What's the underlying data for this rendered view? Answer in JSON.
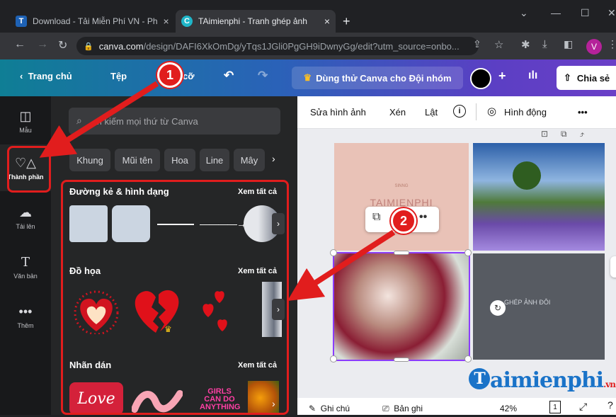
{
  "browser": {
    "tabs": [
      {
        "favicon": "T",
        "title": "Download - Tải Miễn Phí VN - Ph",
        "close": "×"
      },
      {
        "favicon": "C",
        "title": "TAimienphi - Tranh ghép ảnh",
        "close": "×"
      }
    ],
    "new_tab": "+",
    "url_domain": "canva.com",
    "url_path": "/design/DAFI6XkOmDg/yTqs1JGli0PgGH9iDwnyGg/edit?utm_source=onbo...",
    "profile_initial": "V"
  },
  "header": {
    "back_label": "Trang chủ",
    "file_label": "Tệp",
    "resize_label": "cỡ",
    "try_label": "Dùng thử Canva cho Đội nhóm",
    "share_label": "Chia sẻ"
  },
  "rail": {
    "items": [
      {
        "icon": "template-icon",
        "label": "Mẫu"
      },
      {
        "icon": "elements-icon",
        "label": "Thành phần"
      },
      {
        "icon": "upload-icon",
        "label": "Tải lên"
      },
      {
        "icon": "text-icon",
        "label": "Văn bản"
      },
      {
        "icon": "more-icon",
        "label": "Thêm"
      }
    ]
  },
  "panel": {
    "search_placeholder": "m kiếm mọi thứ từ Canva",
    "chips": [
      "Khung",
      "Mũi tên",
      "Hoa",
      "Line",
      "Mây"
    ],
    "sections": [
      {
        "title": "Đường kẻ & hình dạng",
        "see_all": "Xem tất cả"
      },
      {
        "title": "Đồ họa",
        "see_all": "Xem tất cả"
      },
      {
        "title": "Nhãn dán",
        "see_all": "Xem tất cả"
      }
    ],
    "sticker_love": "Love",
    "sticker_girls": "GIRLS CAN DO ANYTHING"
  },
  "toolbar": {
    "edit_image": "Sửa hình ảnh",
    "crop": "Xén",
    "flip": "Lật",
    "animate": "Hình động",
    "more": "•••"
  },
  "canvas": {
    "tile1_small": "SINNG",
    "tile1_title": "TAIMIENPHI",
    "tile4_text": "GHÉP ẢNH ĐÔI"
  },
  "bottom": {
    "notes": "Ghi chú",
    "record": "Bản ghi",
    "zoom": "42%",
    "page": "1"
  },
  "annotations": {
    "badge1": "1",
    "badge2": "2",
    "color": "#e11d1d"
  },
  "watermark": {
    "text": "aimienphi",
    "suffix": ".vn"
  }
}
